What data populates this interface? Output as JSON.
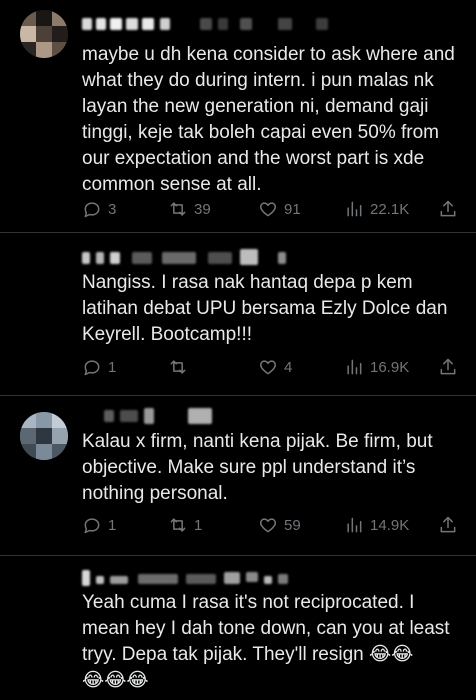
{
  "tweets": [
    {
      "text": "maybe u dh kena consider to ask where and what they do during intern. i pun malas nk layan the new generation ni, demand gaji tinggi, keje tak boleh capai even 50% from our expectation and the worst part is xde common sense at all.",
      "replies": "3",
      "reposts": "39",
      "likes": "91",
      "views": "22.1K"
    },
    {
      "text": "Nangiss. I rasa nak hantaq depa p kem latihan debat UPU bersama Ezly Dolce dan Keyrell. Bootcamp!!!",
      "replies": "1",
      "reposts": "",
      "likes": "4",
      "views": "16.9K"
    },
    {
      "text": "Kalau x firm, nanti kena pijak. Be firm, but objective. Make sure ppl understand it’s nothing personal.",
      "replies": "1",
      "reposts": "1",
      "likes": "59",
      "views": "14.9K"
    },
    {
      "text": "Yeah cuma I rasa it's not reciprocated. I mean hey I dah tone down, can you at least tryy.  Depa tak pijak. They'll resign 😂😂\n😂😂😂"
    }
  ],
  "icons": {
    "reply": "reply-icon",
    "repost": "repost-icon",
    "like": "heart-icon",
    "views": "views-icon",
    "share": "share-icon"
  },
  "colors": {
    "background": "#000000",
    "text": "#e7e9ea",
    "muted": "#71767b",
    "divider": "#2f3336"
  }
}
